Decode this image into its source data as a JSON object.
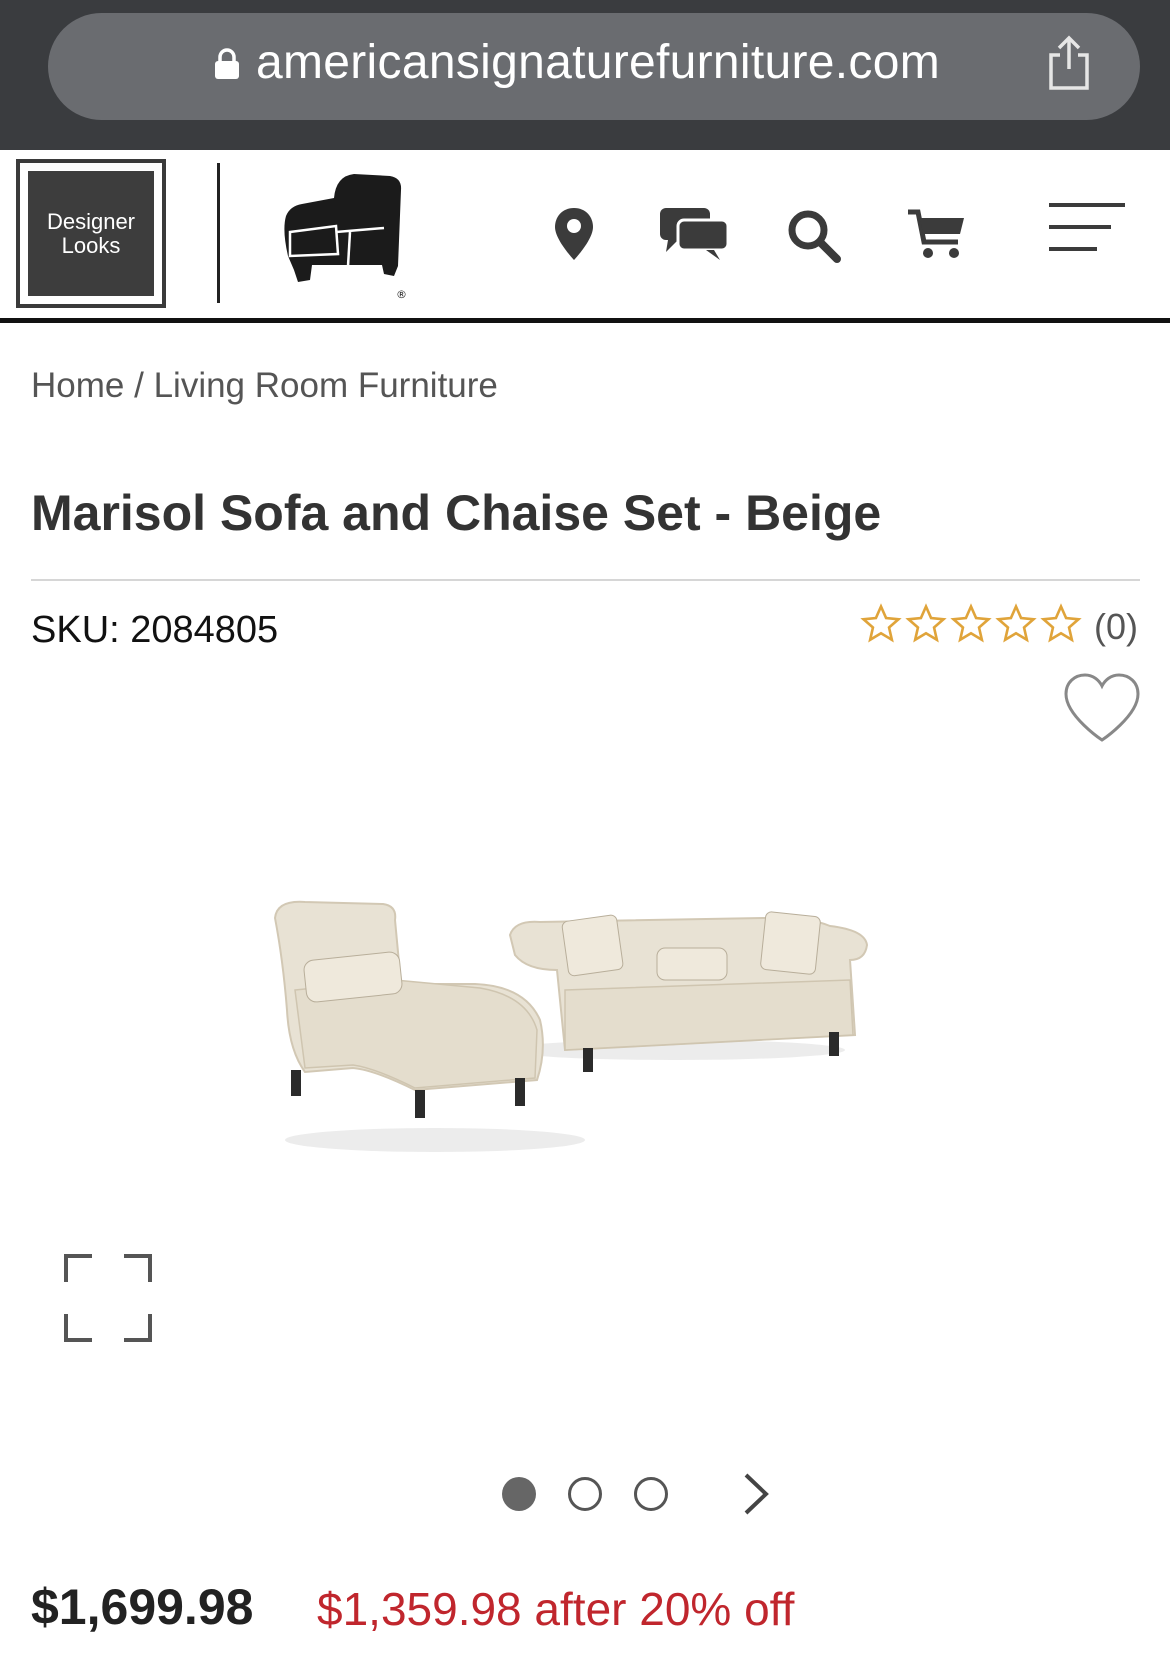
{
  "browser": {
    "url": "americansignaturefurniture.com"
  },
  "header": {
    "logo_line1": "Designer",
    "logo_line2": "Looks",
    "icons": [
      "location-icon",
      "chat-icon",
      "search-icon",
      "cart-icon",
      "menu-icon"
    ]
  },
  "breadcrumb": {
    "home": "Home",
    "separator": "/",
    "category": "Living Room Furniture"
  },
  "product": {
    "title": "Marisol Sofa and Chaise Set - Beige",
    "sku": "SKU: 2084805",
    "rating_stars": 0,
    "rating_max": 5,
    "review_count": "(0)",
    "price": "$1,699.98",
    "sale_price": "$1,359.98 after 20% off"
  },
  "carousel": {
    "total_slides": 3,
    "active_slide": 1
  },
  "colors": {
    "sale_red": "#c0262d",
    "star_gold": "#e0a43a",
    "topbar": "#3a3c3f"
  }
}
